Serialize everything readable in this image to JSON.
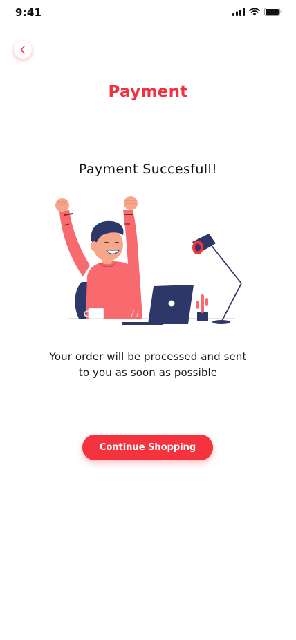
{
  "status_bar": {
    "time": "9:41",
    "icons": [
      "signal-icon",
      "wifi-icon",
      "battery-icon"
    ]
  },
  "header": {
    "back_icon": "chevron-left-icon",
    "title": "Payment"
  },
  "main": {
    "heading": "Payment Succesfull!",
    "illustration": "person-celebrating-at-laptop-illustration",
    "message_line1": "Your order will be processed and sent",
    "message_line2": "to you as soon as possible",
    "continue_label": "Continue Shopping"
  },
  "colors": {
    "accent": "#f5333f",
    "title": "#f0323f",
    "navy": "#2e3868",
    "skin": "#f7a789"
  }
}
